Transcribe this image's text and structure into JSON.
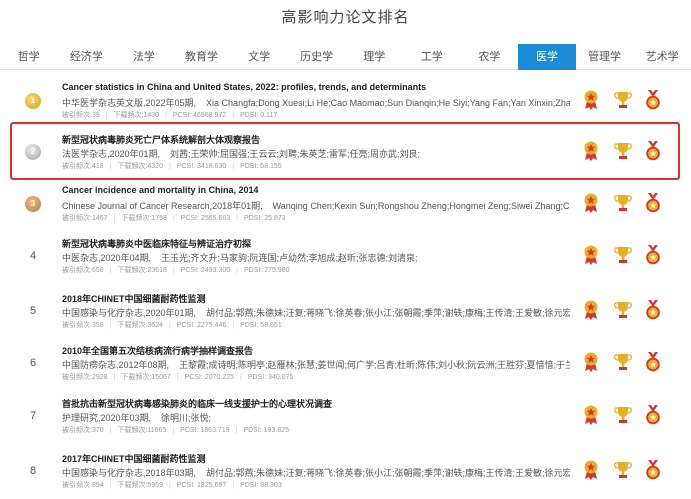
{
  "page_title": "高影响力论文排名",
  "tabs": [
    "哲学",
    "经济学",
    "法学",
    "教育学",
    "文学",
    "历史学",
    "理学",
    "工学",
    "农学",
    "医学",
    "管理学",
    "艺术学"
  ],
  "active_tab": "医学",
  "papers": [
    {
      "rank": "1",
      "title": "Cancer statistics in China and United States, 2022: profiles, trends, and determinants",
      "source": "中华医学杂志英文版,2022年05期,",
      "authors": "Xia Changfa;Dong Xuesi;Li He;Cao Maomao;Sun Dianqin;He Siyi;Yang Fan;Yan Xinxin;Zhang Sha...",
      "citations": "被引频次:39",
      "downloads": "下载频次:1430",
      "pcsi": "PCSI: 46568.972",
      "pdsi": "PDSI: 0.117"
    },
    {
      "rank": "2",
      "title": "新型冠状病毒肺炎死亡尸体系统解剖大体观察报告",
      "source": "法医学杂志,2020年01期,",
      "authors": "刘茜;王荣帅;屈国强;王云云;刘聘;朱英芝;雷军;任亮;周亦武;刘良;",
      "citations": "被引频次:418",
      "downloads": "下载频次:4320",
      "pcsi": "PCSI: 3418.630",
      "pdsi": "PDSI: 58.155"
    },
    {
      "rank": "3",
      "title": "Cancer incidence and mortality in China, 2014",
      "source": "Chinese Journal of Cancer Research,2018年01期,",
      "authors": "Wanqing Chen;Kexin Sun;Rongshou Zheng;Hongmei Zeng;Siwei Zhang;Changf...",
      "citations": "被引频次:1467",
      "downloads": "下载频次:1758",
      "pcsi": "PCSI: 2565.663",
      "pdsi": "PDSI: 25.873"
    },
    {
      "rank": "4",
      "title": "新型冠状病毒肺炎中医临床特征与辨证治疗初探",
      "source": "中医杂志,2020年04期,",
      "authors": "王玉光;齐文升;马家驹;阮连国;卢幼然;李旭成;赵昕;张忠德;刘清泉;",
      "citations": "被引频次:658",
      "downloads": "下载频次:23618",
      "pcsi": "PCSI: 2493.300",
      "pdsi": "PDSI: 275.980"
    },
    {
      "rank": "5",
      "title": "2018年CHINET中国细菌耐药性监测",
      "source": "中国感染与化疗杂志,2020年01期,",
      "authors": "胡付品;郭燕;朱德妹;汪复;蒋晓飞;徐英春;张小江;张朝霞;季萍;谢轶;康梅;王传清;王爱敏;徐元宏;沈继录;孙自...",
      "citations": "被引频次:358",
      "downloads": "下载频次:3624",
      "pcsi": "PCSI: 2275.446",
      "pdsi": "PDSI: 58.651"
    },
    {
      "rank": "6",
      "title": "2010年全国第五次结核病流行病学抽样调查报告",
      "source": "中国防痨杂志,2012年08期,",
      "authors": "王黎霞;成诗明;陈明亭;赵雁林;张慧;姜世闻;何广学;吕青;杜昕;陈伟;刘小秋;阮云洲;王胜芬;夏愔愔;于兰;李峻;李雪;",
      "citations": "被引频次:2928",
      "downloads": "下载频次:15067",
      "pcsi": "PCSI: 2070.225",
      "pdsi": "PDSI: 340.075"
    },
    {
      "rank": "7",
      "title": "首批抗击新型冠状病毒感染肺炎的临床一线支援护士的心理状况调查",
      "source": "护理研究,2020年03期,",
      "authors": "徐明川;张悦;",
      "citations": "被引频次:370",
      "downloads": "下载频次:11665",
      "pcsi": "PCSI: 1863.719",
      "pdsi": "PDSI: 193.825"
    },
    {
      "rank": "8",
      "title": "2017年CHINET中国细菌耐药性监测",
      "source": "中国感染与化疗杂志,2018年03期,",
      "authors": "胡付品;郭燕;朱德妹;汪复;蒋晓飞;徐英春;张小江;张朝霞;季萍;谢轶;康梅;王传清;王爱敏;徐元宏;沈继录;孙自...",
      "citations": "被引频次:894",
      "downloads": "下载频次:5959",
      "pcsi": "PCSI: 1825.697",
      "pdsi": "PDSI: 88.303"
    }
  ],
  "colors": {
    "accent": "#1a8cd8",
    "highlight": "#e0302a",
    "gold": "#e8b020",
    "red": "#d9342b"
  },
  "row_icons": [
    "award-ribbon-icon",
    "trophy-icon",
    "medal-icon"
  ]
}
